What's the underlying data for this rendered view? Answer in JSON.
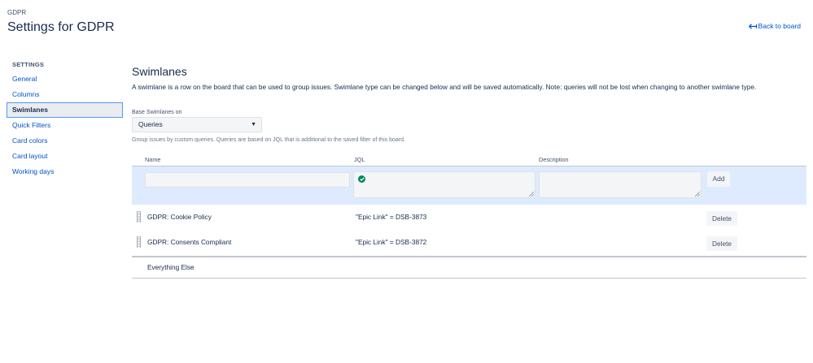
{
  "header": {
    "breadcrumb": "GDPR",
    "title": "Settings for GDPR",
    "back_link": "Back to board"
  },
  "sidebar": {
    "heading": "SETTINGS",
    "items": [
      {
        "label": "General",
        "selected": false
      },
      {
        "label": "Columns",
        "selected": false
      },
      {
        "label": "Swimlanes",
        "selected": true
      },
      {
        "label": "Quick Filters",
        "selected": false
      },
      {
        "label": "Card colors",
        "selected": false
      },
      {
        "label": "Card layout",
        "selected": false
      },
      {
        "label": "Working days",
        "selected": false
      }
    ]
  },
  "main": {
    "title": "Swimlanes",
    "description": "A swimlane is a row on the board that can be used to group issues. Swimlane type can be changed below and will be saved automatically. Note: queries will not be lost when changing to another swimlane type.",
    "base_label": "Base Swimlanes on",
    "base_value": "Queries",
    "help_text": "Group issues by custom queries. Queries are based on JQL that is additional to the saved filter of this board.",
    "columns": {
      "name": "Name",
      "jql": "JQL",
      "description": "Description"
    },
    "add_form": {
      "name_value": "",
      "jql_value": "",
      "description_value": "",
      "add_label": "Add",
      "jql_valid_icon": "check-circle-icon"
    },
    "swimlanes": [
      {
        "name": "GDPR: Cookie Policy",
        "jql": "\"Epic Link\" = DSB-3873",
        "delete_label": "Delete"
      },
      {
        "name": "GDPR: Consents Compliant",
        "jql": "\"Epic Link\" = DSB-3872",
        "delete_label": "Delete"
      }
    ],
    "default_lane": "Everything Else"
  },
  "colors": {
    "link": "#0052cc",
    "selected_bg": "#ebecf0",
    "add_row_bg": "#deebff",
    "success": "#00875a"
  }
}
